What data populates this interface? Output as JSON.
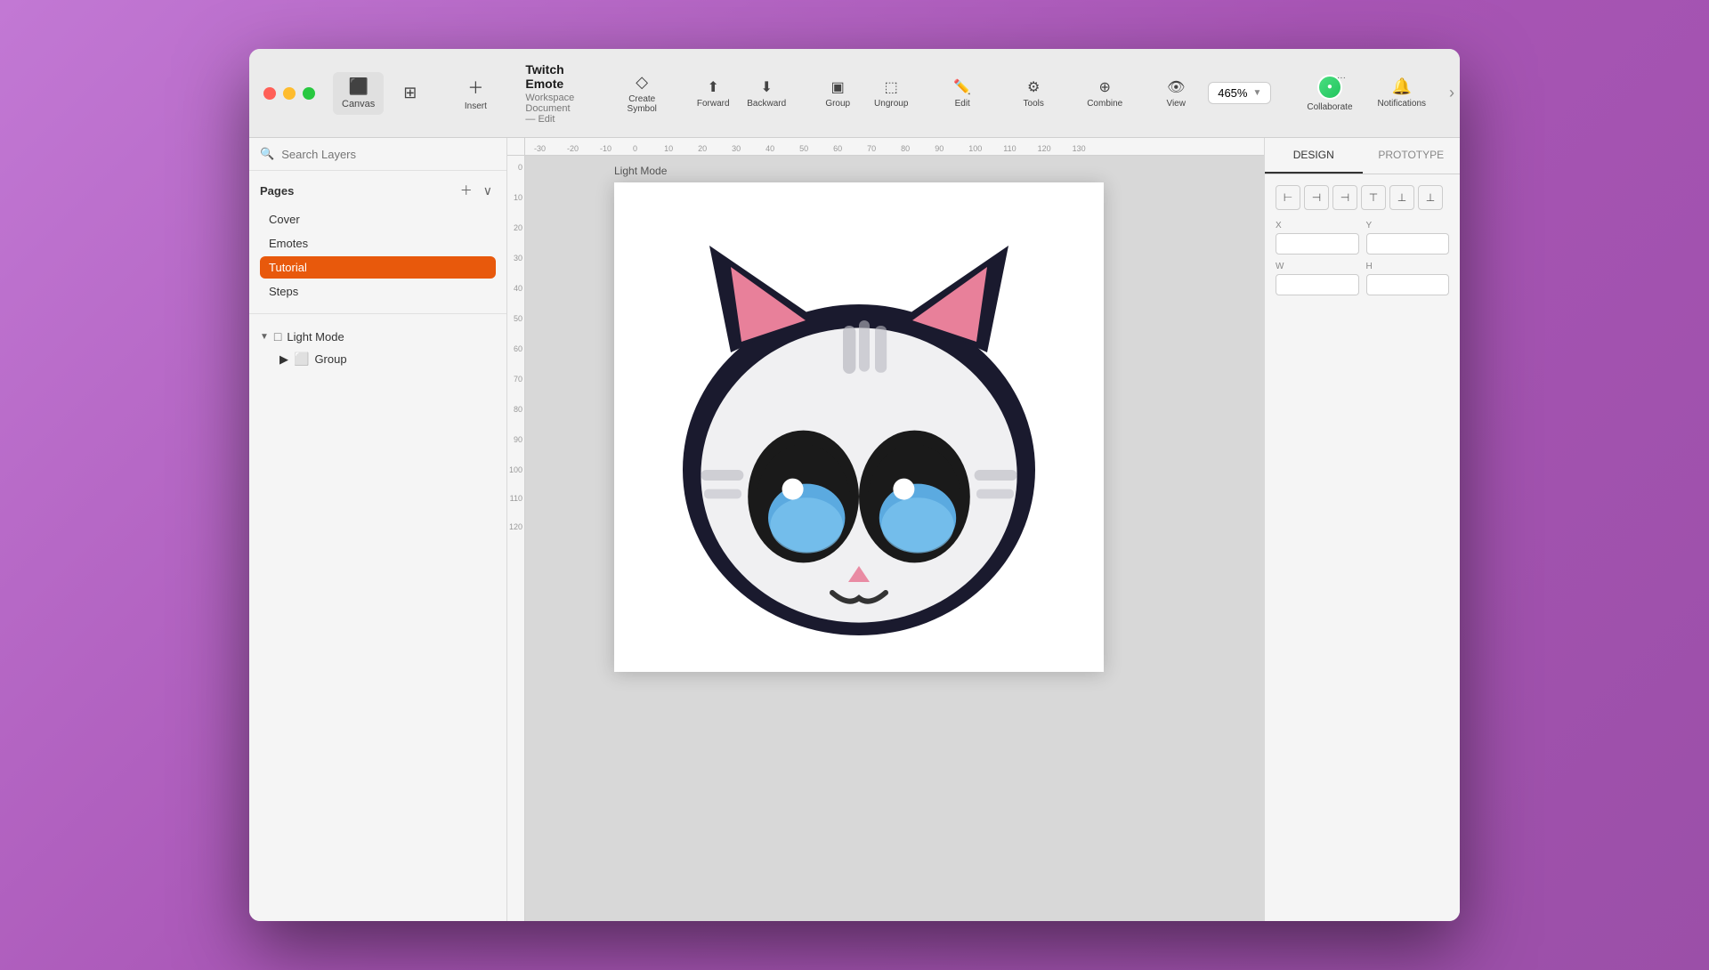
{
  "window": {
    "title": "Twitch Emote",
    "subtitle": "Workspace Document — Edit"
  },
  "toolbar": {
    "canvas_label": "Canvas",
    "insert_label": "Insert",
    "create_symbol_label": "Create Symbol",
    "forward_label": "Forward",
    "backward_label": "Backward",
    "group_label": "Group",
    "ungroup_label": "Ungroup",
    "edit_label": "Edit",
    "tools_label": "Tools",
    "combine_label": "Combine",
    "view_label": "View",
    "collaborate_label": "Collaborate",
    "notifications_label": "Notifications",
    "zoom_level": "465%"
  },
  "sidebar": {
    "search_placeholder": "Search Layers",
    "pages_label": "Pages",
    "pages": [
      {
        "label": "Cover",
        "active": false
      },
      {
        "label": "Emotes",
        "active": false
      },
      {
        "label": "Tutorial",
        "active": true
      },
      {
        "label": "Steps",
        "active": false
      }
    ],
    "layers": [
      {
        "label": "Light Mode",
        "type": "frame",
        "expanded": true
      },
      {
        "label": "Group",
        "type": "group",
        "expanded": false,
        "indent": true
      }
    ]
  },
  "canvas": {
    "artboard_label": "Light Mode",
    "zoom": "465%",
    "ruler_marks": [
      "-30",
      "-20",
      "-10",
      "0",
      "10",
      "20",
      "30",
      "40",
      "50",
      "60",
      "70",
      "80",
      "90",
      "100",
      "110",
      "120",
      "130"
    ],
    "ruler_marks_v": [
      "0",
      "10",
      "20",
      "30",
      "40",
      "50",
      "60",
      "70",
      "80",
      "90",
      "100",
      "110",
      "120"
    ]
  },
  "right_panel": {
    "design_tab": "DESIGN",
    "prototype_tab": "PROTOTYPE",
    "active_tab": "design",
    "x_label": "X",
    "y_label": "Y",
    "w_label": "W",
    "h_label": "H"
  }
}
